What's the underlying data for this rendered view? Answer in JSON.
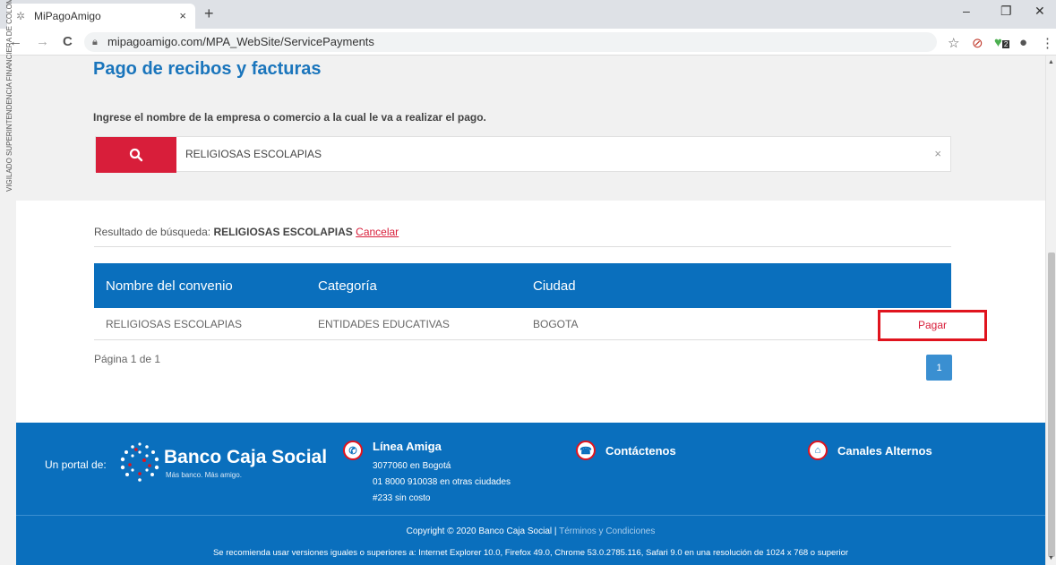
{
  "browser": {
    "tab_title": "MiPagoAmigo",
    "tab_close": "×",
    "new_tab": "+",
    "url": "mipagoamigo.com/MPA_WebSite/ServicePayments",
    "back": "←",
    "forward": "→",
    "reload": "C",
    "minimize": "–",
    "restore": "❐",
    "close": "✕",
    "star": "☆",
    "ext_badge": "2",
    "menu": "⋮"
  },
  "sidebar_badge": "VIGILADO SUPERINTENDENCIA FINANCIERA DE COLOMBIA",
  "page": {
    "title": "Pago de recibos y facturas",
    "instruction": "Ingrese el nombre de la empresa o comercio a la cual le va a realizar el pago.",
    "search_value": "RELIGIOSAS ESCOLAPIAS",
    "clear_icon": "×"
  },
  "results": {
    "label": "Resultado de búsqueda:",
    "term": "RELIGIOSAS ESCOLAPIAS",
    "cancel": "Cancelar",
    "columns": [
      "Nombre del convenio",
      "Categoría",
      "Ciudad"
    ],
    "rows": [
      {
        "name": "RELIGIOSAS ESCOLAPIAS",
        "category": "ENTIDADES EDUCATIVAS",
        "city": "BOGOTA",
        "action": "Pagar"
      }
    ],
    "page_info": "Página 1 de 1",
    "page_button": "1"
  },
  "footer": {
    "portal_label": "Un portal de:",
    "brand": "Banco Caja Social",
    "tagline": "Más banco. Más amigo.",
    "linea_title": "Línea Amiga",
    "linea_lines": [
      "3077060 en Bogotá",
      "01 8000 910038 en otras ciudades",
      "#233 sin costo"
    ],
    "contact": "Contáctenos",
    "canales": "Canales Alternos",
    "copyright": "Copyright © 2020 Banco Caja Social |",
    "terms": "Términos y Condiciones",
    "recommendation": "Se recomienda usar versiones iguales o superiores a: Internet Explorer 10.0, Firefox 49.0, Chrome 53.0.2785.116, Safari 9.0 en una resolución de 1024 x 768 o superior"
  },
  "colors": {
    "primary": "#0a6fbd",
    "accent": "#d81e3a",
    "highlight_box": "#e0141e"
  }
}
